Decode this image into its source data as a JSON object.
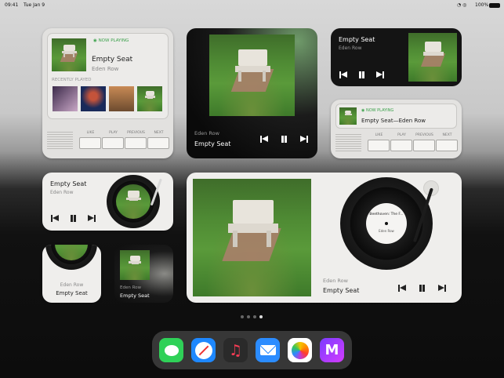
{
  "status_bar": {
    "time": "09:41",
    "date": "Tue Jan 9",
    "battery": "100%"
  },
  "track": {
    "title": "Empty Seat",
    "artist": "Eden Row",
    "combined": "Empty Seat—Eden Row"
  },
  "widget_labels": {
    "now_playing": "NOW PLAYING",
    "recently_played": "RECENTLY PLAYED",
    "keys": [
      "LIKE",
      "PLAY",
      "PREVIOUS",
      "NEXT"
    ]
  },
  "vinyl_label": {
    "title": "Beethoven: The F...",
    "artist": "Eden Row"
  },
  "page_dots": {
    "count": 4,
    "active_index": 3
  },
  "dock_apps": [
    {
      "name": "Messages",
      "icon": "messages-icon",
      "color": "#2fd158"
    },
    {
      "name": "Safari",
      "icon": "safari-icon",
      "color": "#1e88ff"
    },
    {
      "name": "Music",
      "icon": "music-icon",
      "color": "#fa3c55"
    },
    {
      "name": "Mail",
      "icon": "mail-icon",
      "color": "#2b8cff"
    },
    {
      "name": "Photos",
      "icon": "photos-icon",
      "color": "#f4c400"
    },
    {
      "name": "M",
      "icon": "m-app-icon",
      "color": "#7a3cff"
    }
  ],
  "colors": {
    "accent_green": "#3aa14a"
  }
}
